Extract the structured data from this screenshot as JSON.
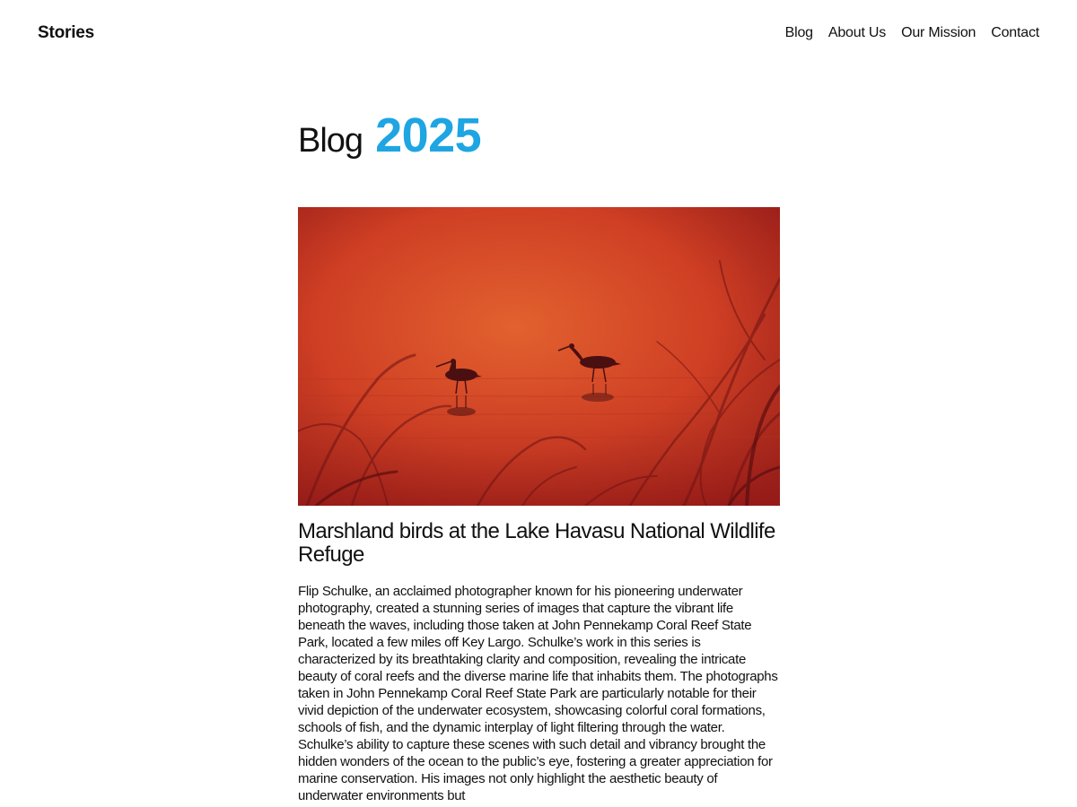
{
  "header": {
    "site_title": "Stories",
    "nav": {
      "blog": "Blog",
      "about": "About Us",
      "mission": "Our Mission",
      "contact": "Contact"
    }
  },
  "main": {
    "heading_word": "Blog",
    "heading_year": "2025",
    "post": {
      "image_subject": "silhouettes of two wading birds at sunset over marsh water",
      "image_colors": {
        "light": "#e05a2c",
        "mid": "#cc3a22",
        "dark": "#7a1212"
      },
      "title": "Marshland birds at the Lake Havasu National Wildlife Refuge",
      "excerpt": "Flip Schulke, an acclaimed photographer known for his pioneering underwater photography, created a stunning series of images that capture the vibrant life beneath the waves, including those taken at John Pennekamp Coral Reef State Park, located a few miles off Key Largo. Schulke’s work in this series is characterized by its breathtaking clarity and composition, revealing the intricate beauty of coral reefs and the diverse marine life that inhabits them. The photographs taken in John Pennekamp Coral Reef State Park are particularly notable for their vivid depiction of the underwater ecosystem, showcasing colorful coral formations, schools of fish, and the dynamic interplay of light filtering through the water. Schulke’s ability to capture these scenes with such detail and vibrancy brought the hidden wonders of the ocean to the public’s eye, fostering a greater appreciation for marine conservation. His images not only highlight the aesthetic beauty of underwater environments but"
    }
  },
  "colors": {
    "accent": "#1ea5e2",
    "text": "#111111",
    "background": "#ffffff"
  }
}
